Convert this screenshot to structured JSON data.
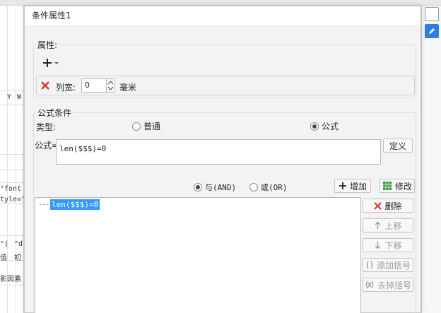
{
  "dialog": {
    "title": "条件属性1",
    "attributes": {
      "label": "属性:",
      "add_icon": "plus-icon",
      "remove_icon": "red-x-icon",
      "column_width_label": "列宽:",
      "column_width_value": "0",
      "unit": "毫米"
    },
    "formula_condition": {
      "label": "公式条件",
      "type_label": "类型:",
      "type_options": [
        "普通",
        "公式"
      ],
      "selected_type": "公式",
      "formula_label": "公式=",
      "formula_value": "len($$$)=0",
      "define_button": "定义"
    },
    "logic": {
      "and_label": "与(AND)",
      "or_label": "或(OR)",
      "selected": "与(AND)",
      "add_button": "增加",
      "modify_button": "修改"
    },
    "condition_list": [
      "len($$$)=0"
    ],
    "side_buttons": {
      "delete": "删除",
      "move_up": "上移",
      "move_down": "下移",
      "add_bracket": "添加括号",
      "remove_bracket": "去掉括号"
    }
  },
  "background": {
    "cells": [
      "Y",
      "W",
      "\"font",
      "tyle=\"",
      "\"(",
      "\"d",
      "值",
      "初",
      "影因素"
    ]
  },
  "colors": {
    "selection": "#3399ff",
    "red_x": "#d9342b",
    "title_bg": "#ffffff"
  }
}
